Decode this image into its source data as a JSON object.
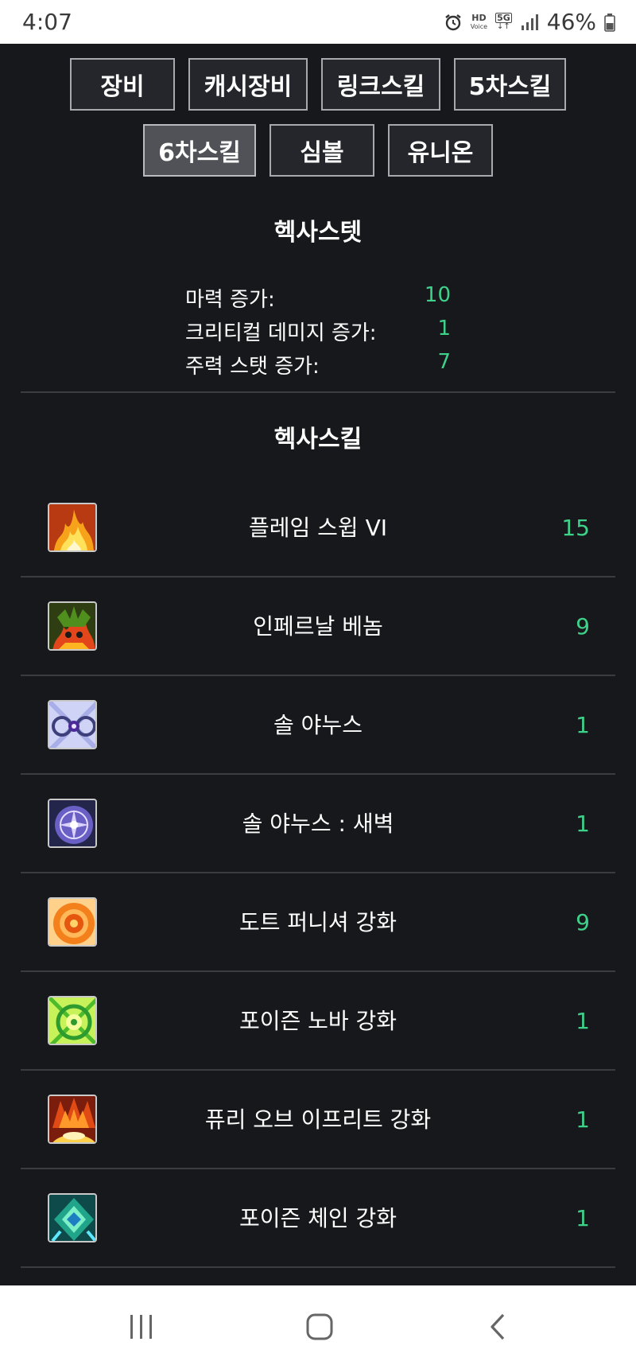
{
  "status_bar": {
    "time": "4:07",
    "hd_label": "HD",
    "voice_label": "Voice",
    "network_label": "5G",
    "battery": "46%"
  },
  "tabs_row1": [
    {
      "label": "장비"
    },
    {
      "label": "캐시장비"
    },
    {
      "label": "링크스킬"
    },
    {
      "label": "5차스킬"
    }
  ],
  "tabs_row2": [
    {
      "label": "6차스킬",
      "active": true
    },
    {
      "label": "심볼"
    },
    {
      "label": "유니온"
    }
  ],
  "hexa_stat": {
    "title": "헥사스텟",
    "rows": [
      {
        "label": "마력 증가:",
        "value": "10"
      },
      {
        "label": "크리티컬 데미지 증가:",
        "value": "1"
      },
      {
        "label": "주력 스탯 증가:",
        "value": "7"
      }
    ]
  },
  "hexa_skill": {
    "title": "헥사스킬",
    "items": [
      {
        "name": "플레임 스윕 VI",
        "level": "15",
        "icon": "flame-sweep-icon"
      },
      {
        "name": "인페르날 베놈",
        "level": "9",
        "icon": "infernal-venom-icon"
      },
      {
        "name": "솔 야누스",
        "level": "1",
        "icon": "sol-janus-icon"
      },
      {
        "name": "솔 야누스 : 새벽",
        "level": "1",
        "icon": "sol-janus-dawn-icon"
      },
      {
        "name": "도트 퍼니셔 강화",
        "level": "9",
        "icon": "dot-punisher-icon"
      },
      {
        "name": "포이즌 노바 강화",
        "level": "1",
        "icon": "poison-nova-icon"
      },
      {
        "name": "퓨리 오브 이프리트 강화",
        "level": "1",
        "icon": "fury-of-ifrit-icon"
      },
      {
        "name": "포이즌 체인 강화",
        "level": "1",
        "icon": "poison-chain-icon"
      }
    ]
  },
  "colors": {
    "background": "#17181b",
    "accent_green": "#3ed18a",
    "tab_border": "#a7a9ad"
  },
  "nav_bar": {
    "recent_icon": "recent-apps-icon",
    "home_icon": "home-icon",
    "back_icon": "back-icon"
  }
}
